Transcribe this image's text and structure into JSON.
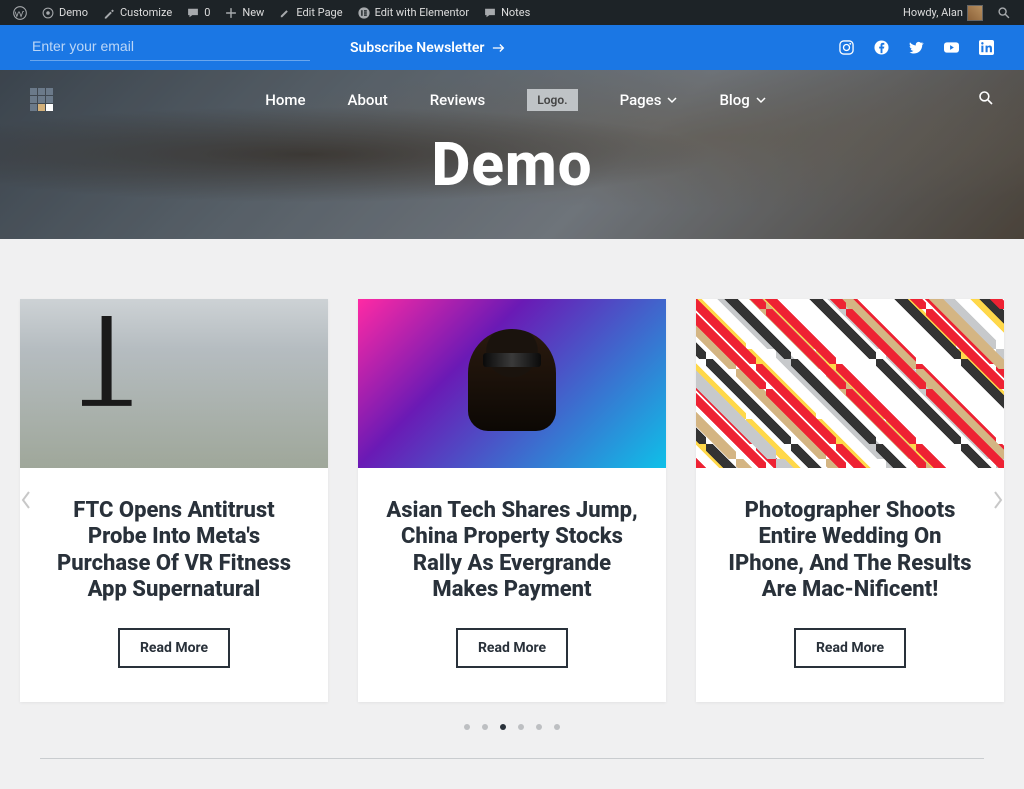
{
  "wp_bar": {
    "site": "Demo",
    "customize": "Customize",
    "comments": "0",
    "new": "New",
    "edit_page": "Edit Page",
    "edit_elementor": "Edit with Elementor",
    "notes": "Notes",
    "howdy": "Howdy, Alan"
  },
  "top_bar": {
    "email_placeholder": "Enter your email",
    "subscribe": "Subscribe Newsletter"
  },
  "nav": {
    "home": "Home",
    "about": "About",
    "reviews": "Reviews",
    "logo_box": "Logo.",
    "pages": "Pages",
    "blog": "Blog"
  },
  "hero": {
    "title": "Demo"
  },
  "cards": [
    {
      "title": "FTC Opens Antitrust Probe Into Meta's Purchase Of VR Fitness App Supernatural",
      "cta": "Read More"
    },
    {
      "title": "Asian Tech Shares Jump, China Property Stocks Rally As Evergrande Makes Payment",
      "cta": "Read More"
    },
    {
      "title": "Photographer Shoots Entire Wedding On IPhone, And The Results Are Mac-Nificent!",
      "cta": "Read More"
    }
  ],
  "carousel": {
    "active_dot": 2,
    "dot_count": 6
  }
}
